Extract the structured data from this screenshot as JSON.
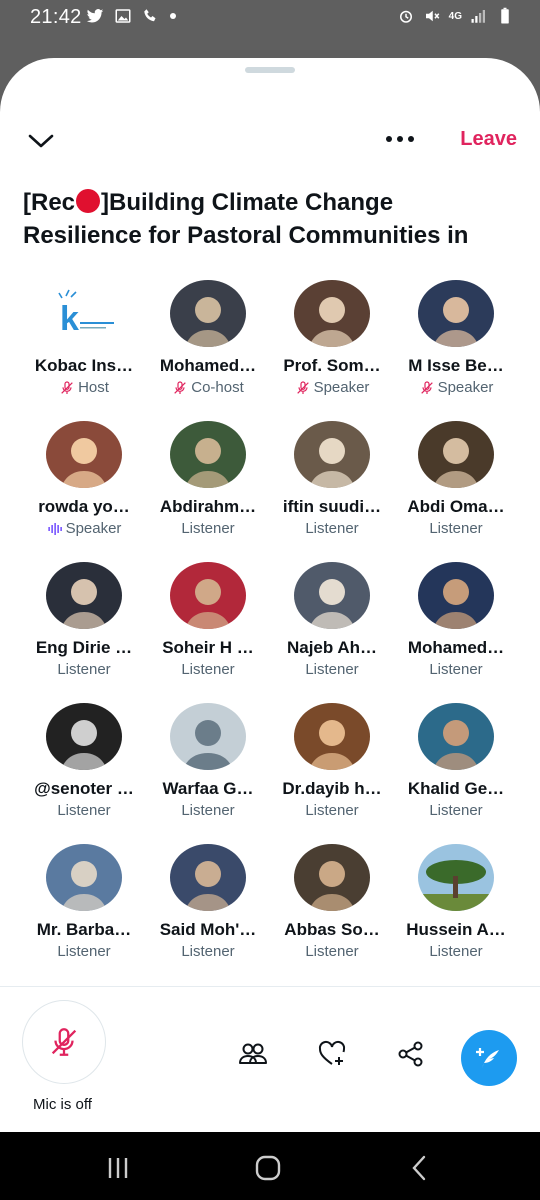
{
  "status_bar": {
    "time": "21:42",
    "network": "4G",
    "icons": [
      "twitter-icon",
      "image-icon",
      "wifi-call-icon",
      "alarm-icon",
      "mute-icon",
      "signal-icon",
      "battery-icon"
    ]
  },
  "header": {
    "leave_label": "Leave",
    "title_before": "[Rec",
    "title_after": "]Building Climate Change Resilience for Pastoral Communities in"
  },
  "participants": [
    {
      "name": "Kobac Ins…",
      "role": "Host",
      "role_icon": "mic-off-icon",
      "avatar": "logo-k"
    },
    {
      "name": "Mohamed…",
      "role": "Co-host",
      "role_icon": "mic-off-icon",
      "avatar": "photo"
    },
    {
      "name": "Prof. Som…",
      "role": "Speaker",
      "role_icon": "mic-off-icon",
      "avatar": "photo"
    },
    {
      "name": "M Isse Be…",
      "role": "Speaker",
      "role_icon": "mic-off-icon",
      "avatar": "photo"
    },
    {
      "name": "rowda yo…",
      "role": "Speaker",
      "role_icon": "speaking-icon",
      "avatar": "photo"
    },
    {
      "name": "Abdirahm…",
      "role": "Listener",
      "avatar": "photo"
    },
    {
      "name": "iftin suudi…",
      "role": "Listener",
      "avatar": "photo"
    },
    {
      "name": "Abdi Oma…",
      "role": "Listener",
      "avatar": "photo"
    },
    {
      "name": "Eng Dirie …",
      "role": "Listener",
      "avatar": "photo"
    },
    {
      "name": "Soheir H …",
      "role": "Listener",
      "avatar": "photo"
    },
    {
      "name": "Najeb Ah…",
      "role": "Listener",
      "avatar": "photo"
    },
    {
      "name": "Mohamed…",
      "role": "Listener",
      "avatar": "photo"
    },
    {
      "name": "@senoter …",
      "role": "Listener",
      "avatar": "photo"
    },
    {
      "name": "Warfaa G…",
      "role": "Listener",
      "avatar": "default"
    },
    {
      "name": "Dr.dayib h…",
      "role": "Listener",
      "avatar": "photo"
    },
    {
      "name": "Khalid Ge…",
      "role": "Listener",
      "avatar": "photo"
    },
    {
      "name": "Mr. Barba…",
      "role": "Listener",
      "avatar": "photo"
    },
    {
      "name": "Said Moh'…",
      "role": "Listener",
      "avatar": "photo"
    },
    {
      "name": "Abbas So…",
      "role": "Listener",
      "avatar": "photo"
    },
    {
      "name": "Hussein A…",
      "role": "Listener",
      "avatar": "tree"
    }
  ],
  "bottom": {
    "mic_label": "Mic is off"
  },
  "colors": {
    "accent": "#1d9bf0",
    "leave": "#e0245e",
    "record": "#e0102f",
    "speaking": "#7856ff"
  }
}
